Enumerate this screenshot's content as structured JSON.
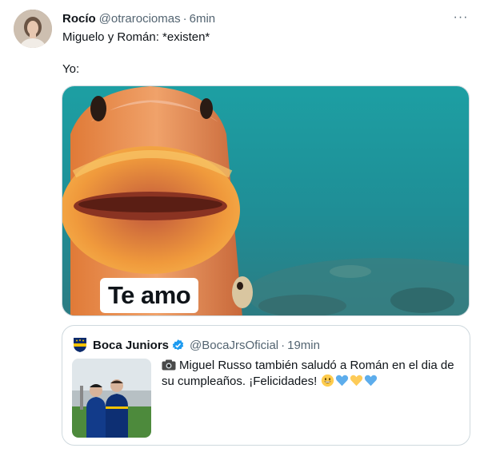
{
  "tweet": {
    "display_name": "Rocío",
    "handle": "@otrarociomas",
    "separator": "·",
    "time": "6min",
    "more_label": "···",
    "line1": "Miguelo y Román: *existen*",
    "line2": "Yo:",
    "media": {
      "caption": "Te amo",
      "icon": "fish-meme-image"
    }
  },
  "quoted": {
    "display_name": "Boca Juniors",
    "verified": true,
    "handle": "@BocaJrsOficial",
    "separator": "·",
    "time": "19min",
    "text": "Miguel Russo también saludó a Román en el dia de su cumpleaños. ¡Felicidades!",
    "emojis": [
      "grinning-face-emoji",
      "blue-heart-emoji",
      "yellow-heart-emoji",
      "blue-heart-emoji"
    ]
  },
  "colors": {
    "text": "#0f1419",
    "secondary": "#536471",
    "border": "#cfd9de",
    "verified": "#1d9bf0",
    "boca_blue": "#0b2a6b",
    "boca_gold": "#f2c200"
  }
}
